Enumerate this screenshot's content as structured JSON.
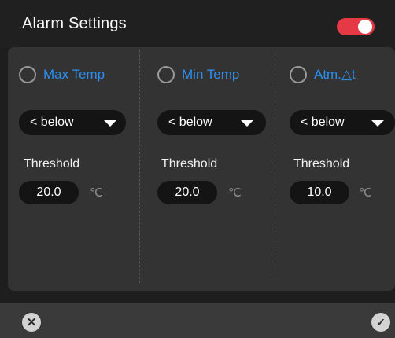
{
  "header": {
    "title": "Alarm Settings",
    "alarm_enabled": true
  },
  "colors": {
    "accent": "#2d8ff0",
    "toggle_on": "#e53a46",
    "panel": "#333333"
  },
  "columns": [
    {
      "label": "Max Temp",
      "selected": false,
      "condition": "< below",
      "threshold_label": "Threshold",
      "threshold_value": "20.0",
      "unit": "℃"
    },
    {
      "label": "Min Temp",
      "selected": false,
      "condition": "< below",
      "threshold_label": "Threshold",
      "threshold_value": "20.0",
      "unit": "℃"
    },
    {
      "label": "Atm.△t",
      "selected": false,
      "condition": "< below",
      "threshold_label": "Threshold",
      "threshold_value": "10.0",
      "unit": "℃"
    }
  ],
  "footer": {
    "cancel_icon": "close-icon",
    "confirm_icon": "check-icon"
  }
}
